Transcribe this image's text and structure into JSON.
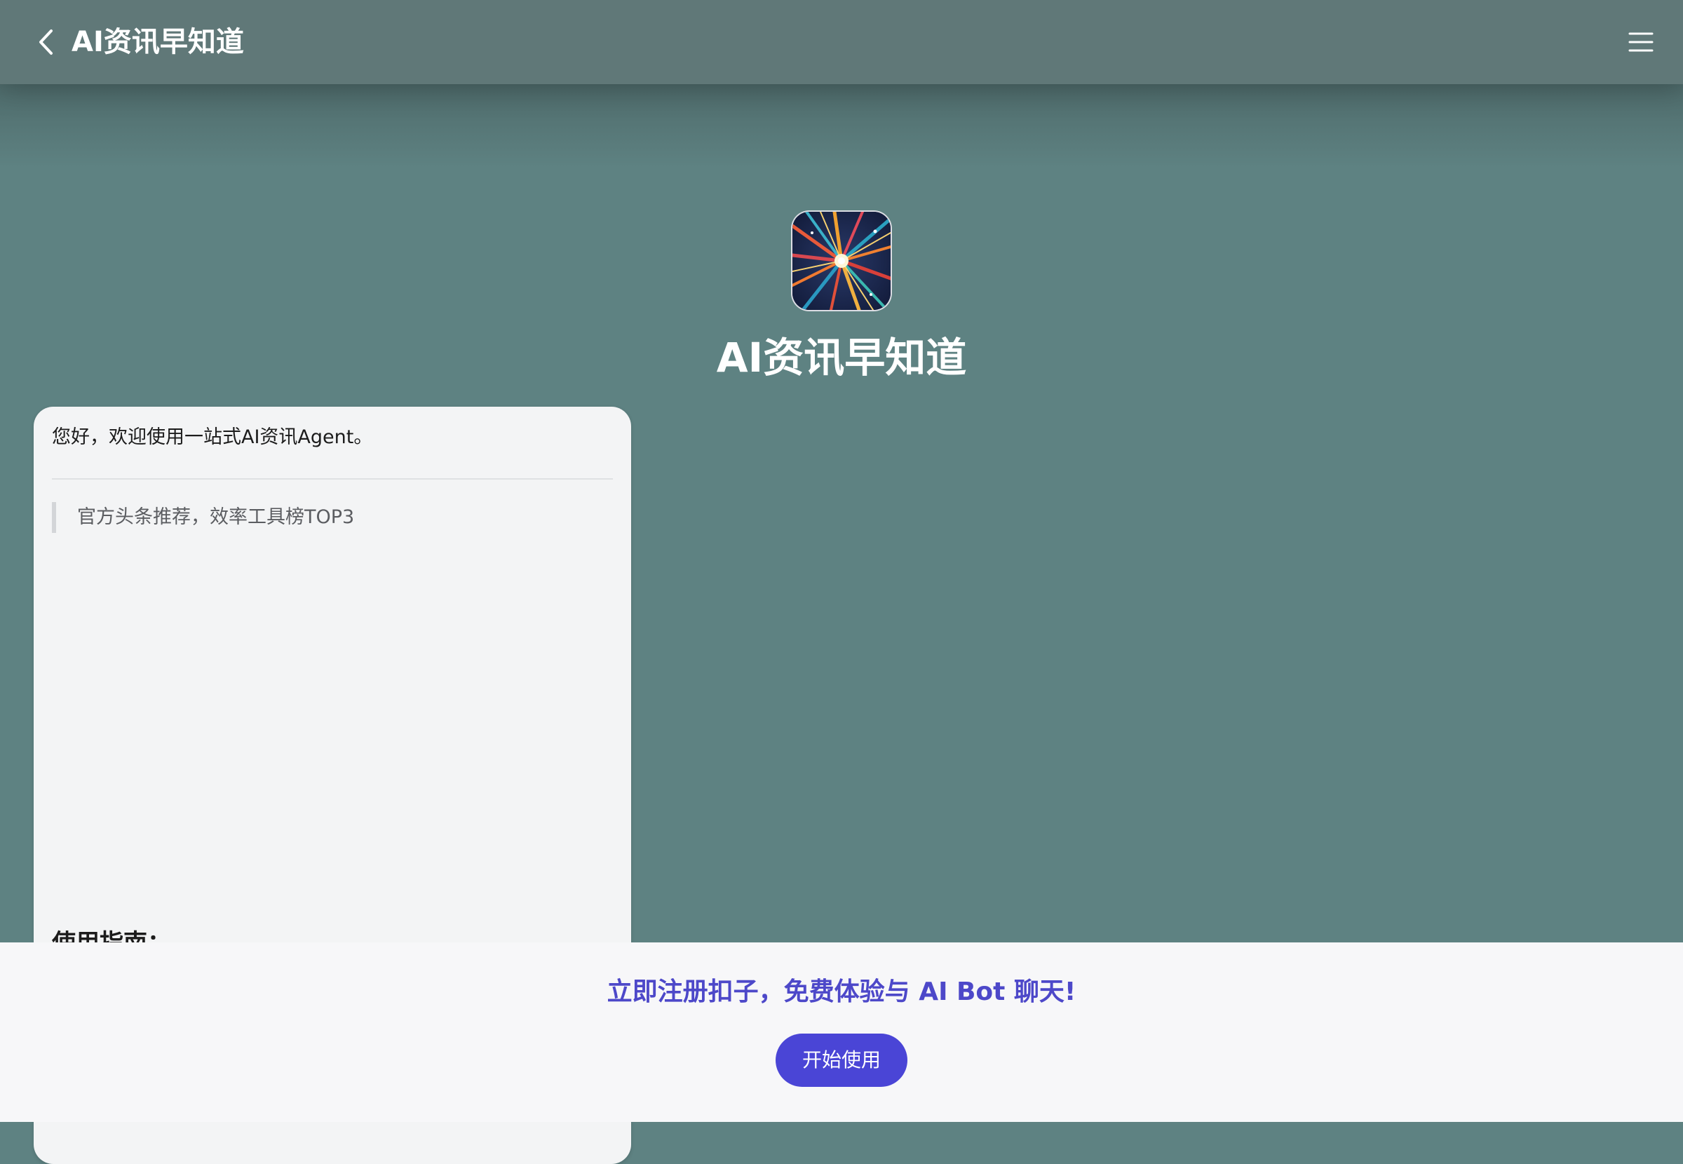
{
  "header": {
    "title": "AI资讯早知道",
    "back_icon": "chevron-left-icon",
    "menu_icon": "hamburger-menu-icon"
  },
  "bot": {
    "name": "AI资讯早知道",
    "avatar_icon": "starburst-avatar"
  },
  "chat": {
    "greeting": "您好，欢迎使用一站式AI资讯Agent。",
    "quote": "官方头条推荐，效率工具榜TOP3",
    "guide_title": "使用指南："
  },
  "footer": {
    "cta": "立即注册扣子，免费体验与 AI Bot 聊天!",
    "button_label": "开始使用"
  },
  "colors": {
    "background": "#5e8282",
    "header": "#607878",
    "accent": "#4a45d6",
    "cta_text": "#4d48c9"
  }
}
